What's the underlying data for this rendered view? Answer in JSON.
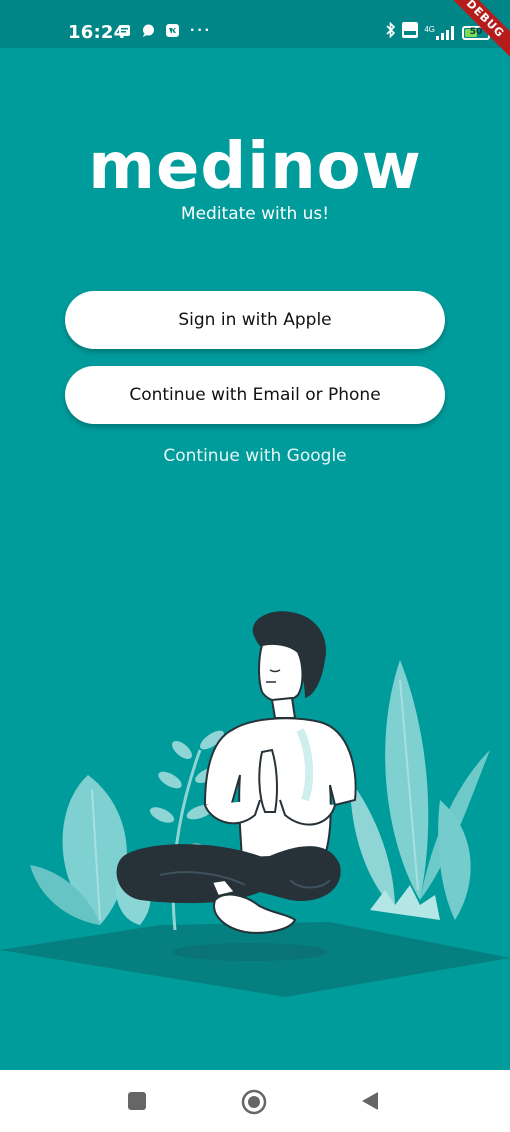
{
  "status_bar": {
    "time": "16:24",
    "battery_level": "50",
    "debug_label": "DEBUG",
    "left_icons": [
      "notes-icon",
      "message-icon",
      "vk-icon",
      "more-icon"
    ],
    "right_icons": [
      "bluetooth-icon",
      "volte-icon",
      "signal-4g-icon",
      "battery-icon"
    ],
    "network_label": "4G"
  },
  "header": {
    "title": "medinow",
    "subtitle": "Meditate with us!"
  },
  "auth": {
    "apple_label": "Sign in with Apple",
    "email_label": "Continue with Email or Phone",
    "google_label": "Continue with Google"
  },
  "colors": {
    "background": "#009c9c",
    "status_bar": "#008686",
    "button_bg": "#ffffff",
    "leaf_light": "#7fd0d0",
    "figure_dark": "#263238"
  },
  "nav": {
    "icons": [
      "recent-apps-icon",
      "home-icon",
      "back-icon"
    ]
  }
}
